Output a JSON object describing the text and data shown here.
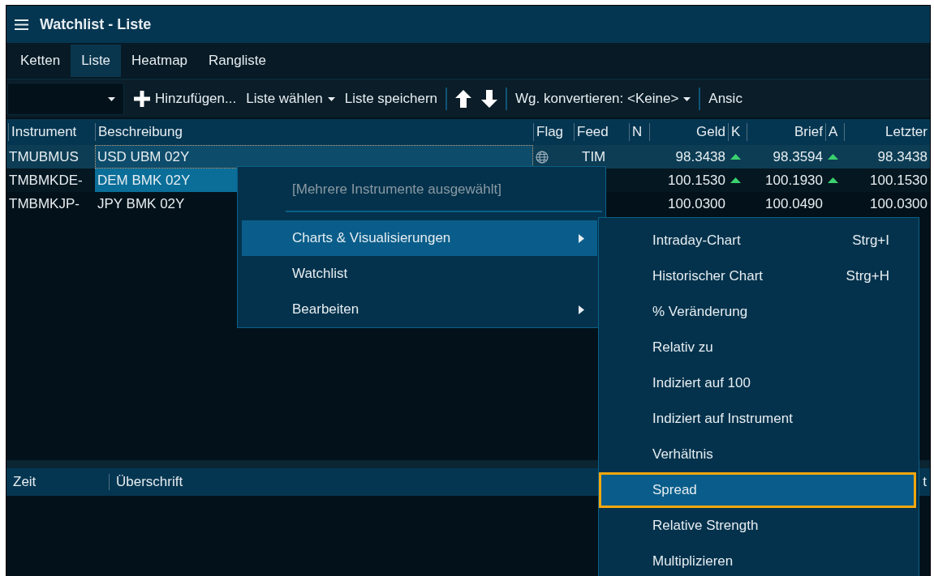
{
  "window": {
    "title": "Watchlist - Liste"
  },
  "tabs": [
    {
      "label": "Ketten",
      "selected": false
    },
    {
      "label": "Liste",
      "selected": true
    },
    {
      "label": "Heatmap",
      "selected": false
    },
    {
      "label": "Rangliste",
      "selected": false
    }
  ],
  "toolbar": {
    "groups": [
      [
        {
          "kind": "combo"
        },
        {
          "kind": "add",
          "label": "Hinzufügen..."
        },
        {
          "kind": "menu",
          "label": "Liste wählen"
        },
        {
          "kind": "button",
          "label": "Liste speichern"
        }
      ],
      [
        {
          "kind": "up"
        },
        {
          "kind": "down"
        }
      ],
      [
        {
          "kind": "menu",
          "label": "Wg. konvertieren: <Keine>"
        }
      ],
      [
        {
          "kind": "button",
          "label": "Ansic"
        }
      ]
    ]
  },
  "table": {
    "columns": [
      {
        "label": "Instrument"
      },
      {
        "label": "Beschreibung"
      },
      {
        "label": "Flag"
      },
      {
        "label": "Feed"
      },
      {
        "label": "N"
      },
      {
        "label": "Geld"
      },
      {
        "label": "K"
      },
      {
        "label": "Brief"
      },
      {
        "label": "A"
      },
      {
        "label": "Letzter"
      }
    ],
    "rows": [
      {
        "instrument": "TMUBMUS",
        "description": "USD UBM 02Y",
        "flag": true,
        "feed": "TIM",
        "bid": "98.3438",
        "bid_rising": true,
        "ask": "98.3594",
        "ask_rising": true,
        "last": "98.3438",
        "selected": true,
        "focused": true
      },
      {
        "instrument": "TMBMKDE-",
        "description": "DEM BMK 02Y",
        "bid": "100.1530",
        "bid_rising": true,
        "ask": "100.1930",
        "ask_rising": true,
        "last": "100.1530",
        "selected": true,
        "focused": false
      },
      {
        "instrument": "TMBMKJP-",
        "description": "JPY BMK 02Y",
        "bid": "100.0300",
        "ask": "100.0490",
        "last": "100.0300",
        "selected": false,
        "focused": false
      }
    ]
  },
  "news": {
    "columns": [
      "Zeit",
      "Überschrift",
      "t"
    ]
  },
  "context_menu": {
    "header": "[Mehrere Instrumente ausgewählt]",
    "items": [
      {
        "label": "Charts & Visualisierungen",
        "submenu": true,
        "selected": true
      },
      {
        "label": "Watchlist",
        "submenu": false,
        "selected": false
      },
      {
        "label": "Bearbeiten",
        "submenu": true,
        "selected": false
      }
    ]
  },
  "submenu": {
    "items": [
      {
        "label": "Intraday-Chart",
        "shortcut": "Strg+I",
        "selected": false
      },
      {
        "label": "Historischer Chart",
        "shortcut": "Strg+H",
        "selected": false
      },
      {
        "label": "% Veränderung",
        "selected": false
      },
      {
        "label": "Relativ zu",
        "selected": false
      },
      {
        "label": "Indiziert auf 100",
        "selected": false
      },
      {
        "label": "Indiziert auf Instrument",
        "selected": false
      },
      {
        "label": "Verhältnis",
        "selected": false
      },
      {
        "label": "Spread",
        "selected": true
      },
      {
        "label": "Relative Strength",
        "selected": false
      },
      {
        "label": "Multiplizieren",
        "selected": false
      }
    ]
  }
}
